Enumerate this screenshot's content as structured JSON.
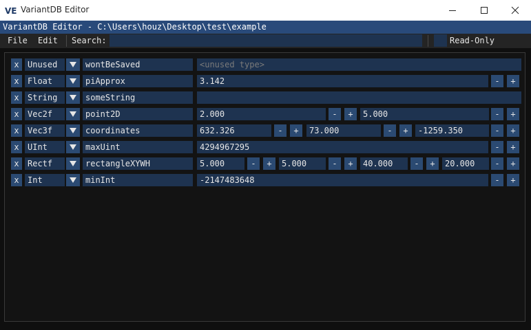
{
  "os_window": {
    "title": "VariantDB Editor",
    "icon": "ve-logo-icon",
    "icon_letters": "VE"
  },
  "window": {
    "title": "VariantDB Editor - C:\\Users\\houz\\Desktop\\test\\example"
  },
  "menubar": {
    "file_label": "File",
    "edit_label": "Edit",
    "search_label": "Search:",
    "search_value": "",
    "readonly_label": "Read-Only",
    "readonly_checked": false
  },
  "entries": [
    {
      "delete_label": "x",
      "type": "Unused",
      "name": "wontBeSaved",
      "values": [],
      "placeholder": "<unused type>"
    },
    {
      "delete_label": "x",
      "type": "Float",
      "name": "piApprox",
      "values": [
        "3.142"
      ]
    },
    {
      "delete_label": "x",
      "type": "String",
      "name": "someString",
      "values": [
        ""
      ]
    },
    {
      "delete_label": "x",
      "type": "Vec2f",
      "name": "point2D",
      "values": [
        "2.000",
        "5.000"
      ]
    },
    {
      "delete_label": "x",
      "type": "Vec3f",
      "name": "coordinates",
      "values": [
        "632.326",
        "73.000",
        "-1259.350"
      ]
    },
    {
      "delete_label": "x",
      "type": "UInt",
      "name": "maxUint",
      "values": [
        "4294967295"
      ]
    },
    {
      "delete_label": "x",
      "type": "Rectf",
      "name": "rectangleXYWH",
      "values": [
        "5.000",
        "5.000",
        "40.000",
        "20.000"
      ]
    },
    {
      "delete_label": "x",
      "type": "Int",
      "name": "minInt",
      "values": [
        "-2147483648"
      ]
    }
  ],
  "stepper": {
    "minus_label": "-",
    "plus_label": "+"
  },
  "colors": {
    "title_bar": "#294a7a",
    "frame_bg": "#1e3350",
    "button": "#2b4a72",
    "window_bg": "#0f0f0f"
  }
}
